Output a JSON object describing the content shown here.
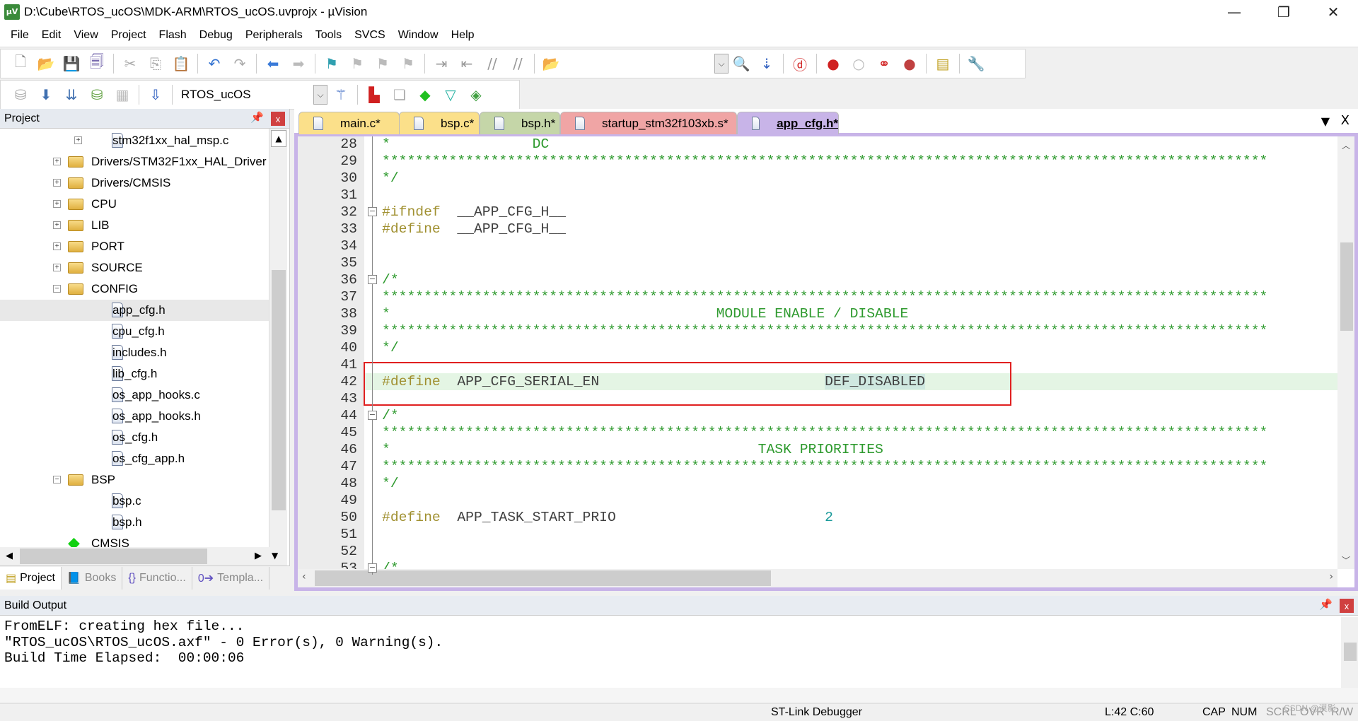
{
  "window": {
    "title": "D:\\Cube\\RTOS_ucOS\\MDK-ARM\\RTOS_ucOS.uvprojx - µVision",
    "app_icon": "µV",
    "minimize": "—",
    "restore": "❐",
    "close": "✕"
  },
  "menu": [
    "File",
    "Edit",
    "View",
    "Project",
    "Flash",
    "Debug",
    "Peripherals",
    "Tools",
    "SVCS",
    "Window",
    "Help"
  ],
  "toolbar1": [
    {
      "name": "new-file-icon",
      "glyph": "🗋",
      "color": "#888"
    },
    {
      "name": "open-file-icon",
      "glyph": "📂",
      "color": "#d09020"
    },
    {
      "name": "save-icon",
      "glyph": "💾",
      "color": "#3050a0"
    },
    {
      "name": "save-all-icon",
      "glyph": "🗐",
      "color": "#6050a0"
    },
    {
      "sep": true
    },
    {
      "name": "cut-icon",
      "glyph": "✂",
      "color": "#aaa"
    },
    {
      "name": "copy-icon",
      "glyph": "⎘",
      "color": "#aaa"
    },
    {
      "name": "paste-icon",
      "glyph": "📋",
      "color": "#c09030"
    },
    {
      "sep": true
    },
    {
      "name": "undo-icon",
      "glyph": "↶",
      "color": "#3070d0"
    },
    {
      "name": "redo-icon",
      "glyph": "↷",
      "color": "#aaa"
    },
    {
      "sep": true
    },
    {
      "name": "navigate-back-icon",
      "glyph": "⬅",
      "color": "#3a7ad8"
    },
    {
      "name": "navigate-forward-icon",
      "glyph": "➡",
      "color": "#bbb"
    },
    {
      "sep": true
    },
    {
      "name": "bookmark-icon",
      "glyph": "⚑",
      "color": "#30a0b0"
    },
    {
      "name": "prev-bookmark-icon",
      "glyph": "⚑",
      "color": "#bbb"
    },
    {
      "name": "next-bookmark-icon",
      "glyph": "⚑",
      "color": "#bbb"
    },
    {
      "name": "clear-bookmarks-icon",
      "glyph": "⚑",
      "color": "#bbb"
    },
    {
      "sep": true
    },
    {
      "name": "indent-icon",
      "glyph": "⇥",
      "color": "#999"
    },
    {
      "name": "unindent-icon",
      "glyph": "⇤",
      "color": "#999"
    },
    {
      "name": "comment-icon",
      "glyph": "//",
      "color": "#999"
    },
    {
      "name": "uncomment-icon",
      "glyph": "//",
      "color": "#999"
    },
    {
      "sep": true
    },
    {
      "name": "find-in-files-icon",
      "glyph": "📂",
      "color": "#c09030"
    }
  ],
  "toolbar1_right": [
    {
      "name": "find-icon",
      "glyph": "🔍",
      "color": "#555"
    },
    {
      "name": "incremental-find-icon",
      "glyph": "⇣",
      "color": "#3060c0"
    },
    {
      "sep": true
    },
    {
      "name": "debug-session-icon",
      "glyph": "ⓓ",
      "color": "#d02020"
    },
    {
      "sep": true
    },
    {
      "name": "breakpoint-icon",
      "glyph": "●",
      "color": "#d02020"
    },
    {
      "name": "disable-breakpoint-icon",
      "glyph": "○",
      "color": "#bbb"
    },
    {
      "name": "disable-all-breakpoints-icon",
      "glyph": "⚭",
      "color": "#d02020"
    },
    {
      "name": "kill-all-breakpoints-icon",
      "glyph": "●",
      "color": "#c04040"
    },
    {
      "sep": true
    },
    {
      "name": "window-layout-icon",
      "glyph": "▤",
      "color": "#c0a020"
    },
    {
      "sep": true
    },
    {
      "name": "configure-icon",
      "glyph": "🔧",
      "color": "#4070b0"
    }
  ],
  "toolbar2": [
    {
      "name": "translate-icon",
      "glyph": "⛁",
      "color": "#aaa"
    },
    {
      "name": "build-icon",
      "glyph": "⬇",
      "color": "#4070b0"
    },
    {
      "name": "rebuild-icon",
      "glyph": "⇊",
      "color": "#4070b0"
    },
    {
      "name": "batch-build-icon",
      "glyph": "⛁",
      "color": "#60a040"
    },
    {
      "name": "stop-build-icon",
      "glyph": "▦",
      "color": "#bbb"
    },
    {
      "sep": true
    },
    {
      "name": "load-icon",
      "glyph": "⇩",
      "color": "#3060c0"
    }
  ],
  "target": {
    "selected": "RTOS_ucOS"
  },
  "toolbar2_right": [
    {
      "name": "options-for-target-icon",
      "glyph": "⚚",
      "color": "#3060c0"
    },
    {
      "sep": true
    },
    {
      "name": "file-extensions-icon",
      "glyph": "▙",
      "color": "#d02020"
    },
    {
      "name": "manage-multi-project-icon",
      "glyph": "❏",
      "color": "#aaa"
    },
    {
      "name": "manage-run-time-environment-icon",
      "glyph": "◆",
      "color": "#20c020"
    },
    {
      "name": "select-software-packs-icon",
      "glyph": "▽",
      "color": "#20b0a0"
    },
    {
      "name": "pack-installer-icon",
      "glyph": "◈",
      "color": "#40a040"
    }
  ],
  "project_pane": {
    "title": "Project",
    "pin": "📌",
    "close": "x",
    "tree": [
      {
        "label": "stm32f1xx_hal_msp.c",
        "level": 2,
        "kind": "file",
        "expander": "+"
      },
      {
        "label": "Drivers/STM32F1xx_HAL_Driver",
        "level": 1,
        "kind": "folder",
        "expander": "+"
      },
      {
        "label": "Drivers/CMSIS",
        "level": 1,
        "kind": "folder",
        "expander": "+"
      },
      {
        "label": "CPU",
        "level": 1,
        "kind": "folder",
        "expander": "+"
      },
      {
        "label": "LIB",
        "level": 1,
        "kind": "folder",
        "expander": "+"
      },
      {
        "label": "PORT",
        "level": 1,
        "kind": "folder",
        "expander": "+"
      },
      {
        "label": "SOURCE",
        "level": 1,
        "kind": "folder",
        "expander": "+"
      },
      {
        "label": "CONFIG",
        "level": 1,
        "kind": "folder",
        "expander": "−"
      },
      {
        "label": "app_cfg.h",
        "level": 2,
        "kind": "file",
        "selected": true
      },
      {
        "label": "cpu_cfg.h",
        "level": 2,
        "kind": "file"
      },
      {
        "label": "includes.h",
        "level": 2,
        "kind": "file"
      },
      {
        "label": "lib_cfg.h",
        "level": 2,
        "kind": "file"
      },
      {
        "label": "os_app_hooks.c",
        "level": 2,
        "kind": "file"
      },
      {
        "label": "os_app_hooks.h",
        "level": 2,
        "kind": "file"
      },
      {
        "label": "os_cfg.h",
        "level": 2,
        "kind": "file"
      },
      {
        "label": "os_cfg_app.h",
        "level": 2,
        "kind": "file"
      },
      {
        "label": "BSP",
        "level": 1,
        "kind": "folder",
        "expander": "−"
      },
      {
        "label": "bsp.c",
        "level": 2,
        "kind": "file"
      },
      {
        "label": "bsp.h",
        "level": 2,
        "kind": "file"
      },
      {
        "label": "CMSIS",
        "level": 1,
        "kind": "component"
      }
    ],
    "bottom_tabs": [
      {
        "label": "Project",
        "icon": "▤",
        "active": true
      },
      {
        "label": "Books",
        "icon": "📘"
      },
      {
        "label": "Functio...",
        "icon": "{}"
      },
      {
        "label": "Templa...",
        "icon": "0➔"
      }
    ]
  },
  "editor": {
    "tabs": [
      {
        "label": "main.c*",
        "color": "#fbe08a"
      },
      {
        "label": "bsp.c*",
        "color": "#fbe08a"
      },
      {
        "label": "bsp.h*",
        "color": "#c5d6a8"
      },
      {
        "label": "startup_stm32f103xb.s*",
        "color": "#f0a5a5"
      },
      {
        "label": "app_cfg.h*",
        "color": "#c8b4e8",
        "active": true
      }
    ],
    "tab_menu": "▼",
    "tab_close": "X",
    "current_line": 42,
    "lines": [
      {
        "n": "28",
        "s": [
          [
            "cmt",
            "*                 DC"
          ]
        ]
      },
      {
        "n": "29",
        "s": [
          [
            "cmt",
            "**********************************************************************************************************"
          ]
        ]
      },
      {
        "n": "30",
        "s": [
          [
            "cmt",
            "*/"
          ]
        ]
      },
      {
        "n": "31",
        "s": []
      },
      {
        "n": "32",
        "s": [
          [
            "pp",
            "#ifndef"
          ],
          [
            "id",
            "  __APP_CFG_H__"
          ]
        ]
      },
      {
        "n": "33",
        "s": [
          [
            "pp",
            "#define"
          ],
          [
            "id",
            "  __APP_CFG_H__"
          ]
        ]
      },
      {
        "n": "34",
        "s": []
      },
      {
        "n": "35",
        "s": []
      },
      {
        "n": "36",
        "s": [
          [
            "cmt",
            "/*"
          ]
        ]
      },
      {
        "n": "37",
        "s": [
          [
            "cmt",
            "**********************************************************************************************************"
          ]
        ]
      },
      {
        "n": "38",
        "s": [
          [
            "cmt",
            "*                                       MODULE ENABLE / DISABLE"
          ]
        ]
      },
      {
        "n": "39",
        "s": [
          [
            "cmt",
            "**********************************************************************************************************"
          ]
        ]
      },
      {
        "n": "40",
        "s": [
          [
            "cmt",
            "*/"
          ]
        ]
      },
      {
        "n": "41",
        "s": []
      },
      {
        "n": "42",
        "s": [
          [
            "pp",
            "#define"
          ],
          [
            "id",
            "  APP_CFG_SERIAL_EN                           "
          ],
          [
            "hl",
            "DEF_DISABLED"
          ]
        ]
      },
      {
        "n": "43",
        "s": []
      },
      {
        "n": "44",
        "s": [
          [
            "cmt",
            "/*"
          ]
        ]
      },
      {
        "n": "45",
        "s": [
          [
            "cmt",
            "**********************************************************************************************************"
          ]
        ]
      },
      {
        "n": "46",
        "s": [
          [
            "cmt",
            "*                                            TASK PRIORITIES"
          ]
        ]
      },
      {
        "n": "47",
        "s": [
          [
            "cmt",
            "**********************************************************************************************************"
          ]
        ]
      },
      {
        "n": "48",
        "s": [
          [
            "cmt",
            "*/"
          ]
        ]
      },
      {
        "n": "49",
        "s": []
      },
      {
        "n": "50",
        "s": [
          [
            "pp",
            "#define"
          ],
          [
            "id",
            "  APP_TASK_START_PRIO                         "
          ],
          [
            "num",
            "2"
          ]
        ]
      },
      {
        "n": "51",
        "s": []
      },
      {
        "n": "52",
        "s": []
      },
      {
        "n": "53",
        "s": [
          [
            "cmt",
            "/*"
          ]
        ]
      }
    ]
  },
  "build_output": {
    "title": "Build Output",
    "lines": [
      "FromELF: creating hex file...",
      "\"RTOS_ucOS\\RTOS_ucOS.axf\" - 0 Error(s), 0 Warning(s).",
      "Build Time Elapsed:  00:00:06"
    ]
  },
  "statusbar": {
    "debugger": "ST-Link Debugger",
    "position": "L:42 C:60",
    "cap": "CAP",
    "num": "NUM",
    "scrl": "SCRL",
    "ovr": "OVR",
    "rw": "R/W",
    "watermark": "CSDN @漠影"
  }
}
